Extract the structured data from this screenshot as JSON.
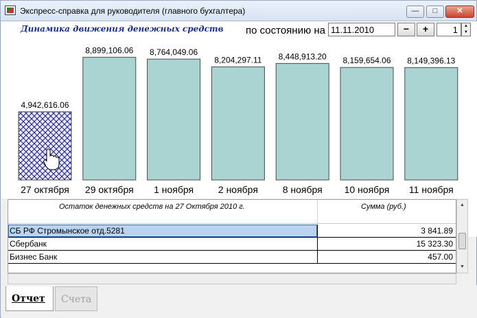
{
  "window": {
    "title": "Экспресс-справка для руководителя (главного бухгалтера)",
    "min_label": "—",
    "max_label": "□",
    "close_label": "✕"
  },
  "header": {
    "chart_title": "Динамика движения денежных средств",
    "state_label": "по состоянию на",
    "date_value": "11.11.2010",
    "minus_label": "−",
    "plus_label": "+",
    "count_value": "1"
  },
  "chart_data": {
    "type": "bar",
    "categories": [
      "27 октября",
      "29 октября",
      "1 ноября",
      "2 ноября",
      "8 ноября",
      "10 ноября",
      "11 ноября"
    ],
    "values": [
      4942616.06,
      8899106.06,
      8764049.06,
      8204297.11,
      8448913.2,
      8159654.06,
      8149396.13
    ],
    "value_labels": [
      "4,942,616.06",
      "8,899,106.06",
      "8,764,049.06",
      "8,204,297.11",
      "8,448,913.20",
      "8,159,654.06",
      "8,149,396.13"
    ],
    "selected_index": 0,
    "colors": {
      "bar": "#a9d4d2",
      "bar_stroke": "#4a4a4a",
      "selected_hatch": "#1c1c8c"
    },
    "ylim": [
      0,
      9500000
    ]
  },
  "grid": {
    "headers": [
      "Остаток денежных средств на 27 Октября 2010 г.",
      "Сумма (руб.)"
    ],
    "rows": [
      {
        "name": "СБ РФ Стромынское отд.5281",
        "amount": "3 841.89"
      },
      {
        "name": "Сбербанк",
        "amount": "15 323.30"
      },
      {
        "name": "Бизнес Банк",
        "amount": "457.00"
      }
    ]
  },
  "tabs": [
    {
      "label": "Отчет"
    },
    {
      "label": "Счета"
    }
  ]
}
